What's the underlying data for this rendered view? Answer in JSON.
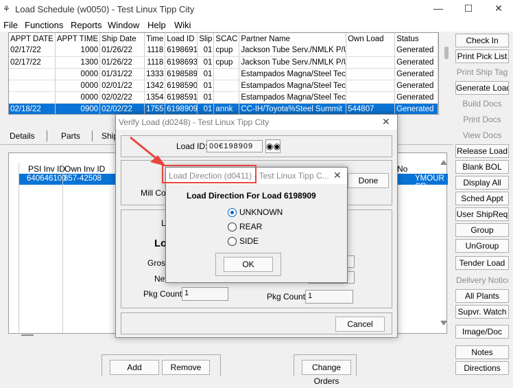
{
  "window": {
    "title": "Load Schedule (w0050) - Test Linux Tipp City",
    "controls": [
      "—",
      "☐",
      "✕"
    ]
  },
  "menu": [
    "File",
    "Functions",
    "Reports",
    "Window",
    "Help",
    "Wiki"
  ],
  "grid": {
    "columns": [
      "APPT DATE",
      "APPT TIME",
      "Ship Date",
      "Time",
      "Load ID",
      "Slip",
      "SCAC",
      "Partner Name",
      "Own Load",
      "Status"
    ],
    "rows": [
      [
        "02/17/22",
        "1000",
        "01/26/22",
        "1118",
        "6198691",
        "01",
        "cpup",
        "Jackson Tube Serv./NMLK P/U",
        "",
        "Generated"
      ],
      [
        "02/17/22",
        "1300",
        "01/26/22",
        "1118",
        "6198693",
        "01",
        "cpup",
        "Jackson Tube Serv./NMLK P/U",
        "",
        "Generated"
      ],
      [
        "",
        "0000",
        "01/31/22",
        "1333",
        "6198589",
        "01",
        "",
        "Estampados Magna/Steel Tech",
        "",
        "Generated"
      ],
      [
        "",
        "0000",
        "02/01/22",
        "1342",
        "6198590",
        "01",
        "",
        "Estampados Magna/Steel Tech",
        "",
        "Generated"
      ],
      [
        "",
        "0000",
        "02/02/22",
        "1354",
        "6198591",
        "01",
        "",
        "Estampados Magna/Steel Tech",
        "",
        "Generated"
      ],
      [
        "02/18/22",
        "0900",
        "02/02/22",
        "1755",
        "6198909",
        "01",
        "annk",
        "CC-IH/Toyota%Steel Summit",
        "544807",
        "Generated"
      ]
    ],
    "selected_row": 5
  },
  "side_buttons": [
    {
      "label": "Check In",
      "enabled": true
    },
    {
      "label": "Print Pick List",
      "enabled": true
    },
    {
      "label": "Print Ship Tag",
      "enabled": false
    },
    {
      "label": "Generate Load",
      "enabled": true
    },
    {
      "label": "Build Docs",
      "enabled": false
    },
    {
      "label": "Print Docs",
      "enabled": false
    },
    {
      "label": "View Docs",
      "enabled": false
    },
    {
      "label": "Release Load",
      "enabled": true
    },
    {
      "label": "Blank BOL",
      "enabled": true
    },
    {
      "label": "Display All",
      "enabled": true
    },
    {
      "label": "Sched Appt",
      "enabled": true
    },
    {
      "label": "User ShipReq",
      "enabled": true
    },
    {
      "label": "Group",
      "enabled": true
    },
    {
      "label": "UnGroup",
      "enabled": true
    },
    {
      "label": "Tender Load",
      "enabled": true
    },
    {
      "label": "Delivery Notice",
      "enabled": false
    },
    {
      "label": "All Plants",
      "enabled": true
    },
    {
      "label": "Supvr. Watch",
      "enabled": true
    },
    {
      "label": "Image/Doc",
      "enabled": true
    },
    {
      "label": "Notes",
      "enabled": true
    },
    {
      "label": "Directions",
      "enabled": true
    }
  ],
  "tabs": [
    "Details",
    "Parts",
    "Ship"
  ],
  "detail": {
    "headers": [
      "PSI Inv ID",
      "Own Inv ID"
    ],
    "row": [
      "640646100",
      "857-42508"
    ],
    "right_header": "No",
    "right_cell": "YMOUR CR"
  },
  "bottom_buttons": {
    "add": "Add",
    "remove": "Remove",
    "change_orders": "Change Orders"
  },
  "verify_dialog": {
    "title": "Verify Load (d0248) - Test Linux Tipp City",
    "load_id_label": "Load ID:",
    "load_id_value": "00€198909",
    "mill_coil_label": "Mill Coil",
    "done_label": "Done",
    "frag_l": "L",
    "frag_lo": "Lo",
    "gross_label": "Gross",
    "net_label": "Net",
    "pkg_count_label": "Pkg Count:",
    "pkg_count_left": "1",
    "pkg_count_label_right": "Pkg Count:",
    "pkg_count_right": "1",
    "cancel_label": "Cancel"
  },
  "load_direction": {
    "title": "Load Direction (d0411) - Test Linux Tipp C...",
    "heading": "Load Direction For Load 6198909",
    "options": [
      "UNKNOWN",
      "REAR",
      "SIDE"
    ],
    "selected": 0,
    "ok_label": "OK"
  },
  "colors": {
    "selection": "#0a74d6",
    "highlight_box": "#e8473c",
    "arrow": "#e8473c"
  }
}
